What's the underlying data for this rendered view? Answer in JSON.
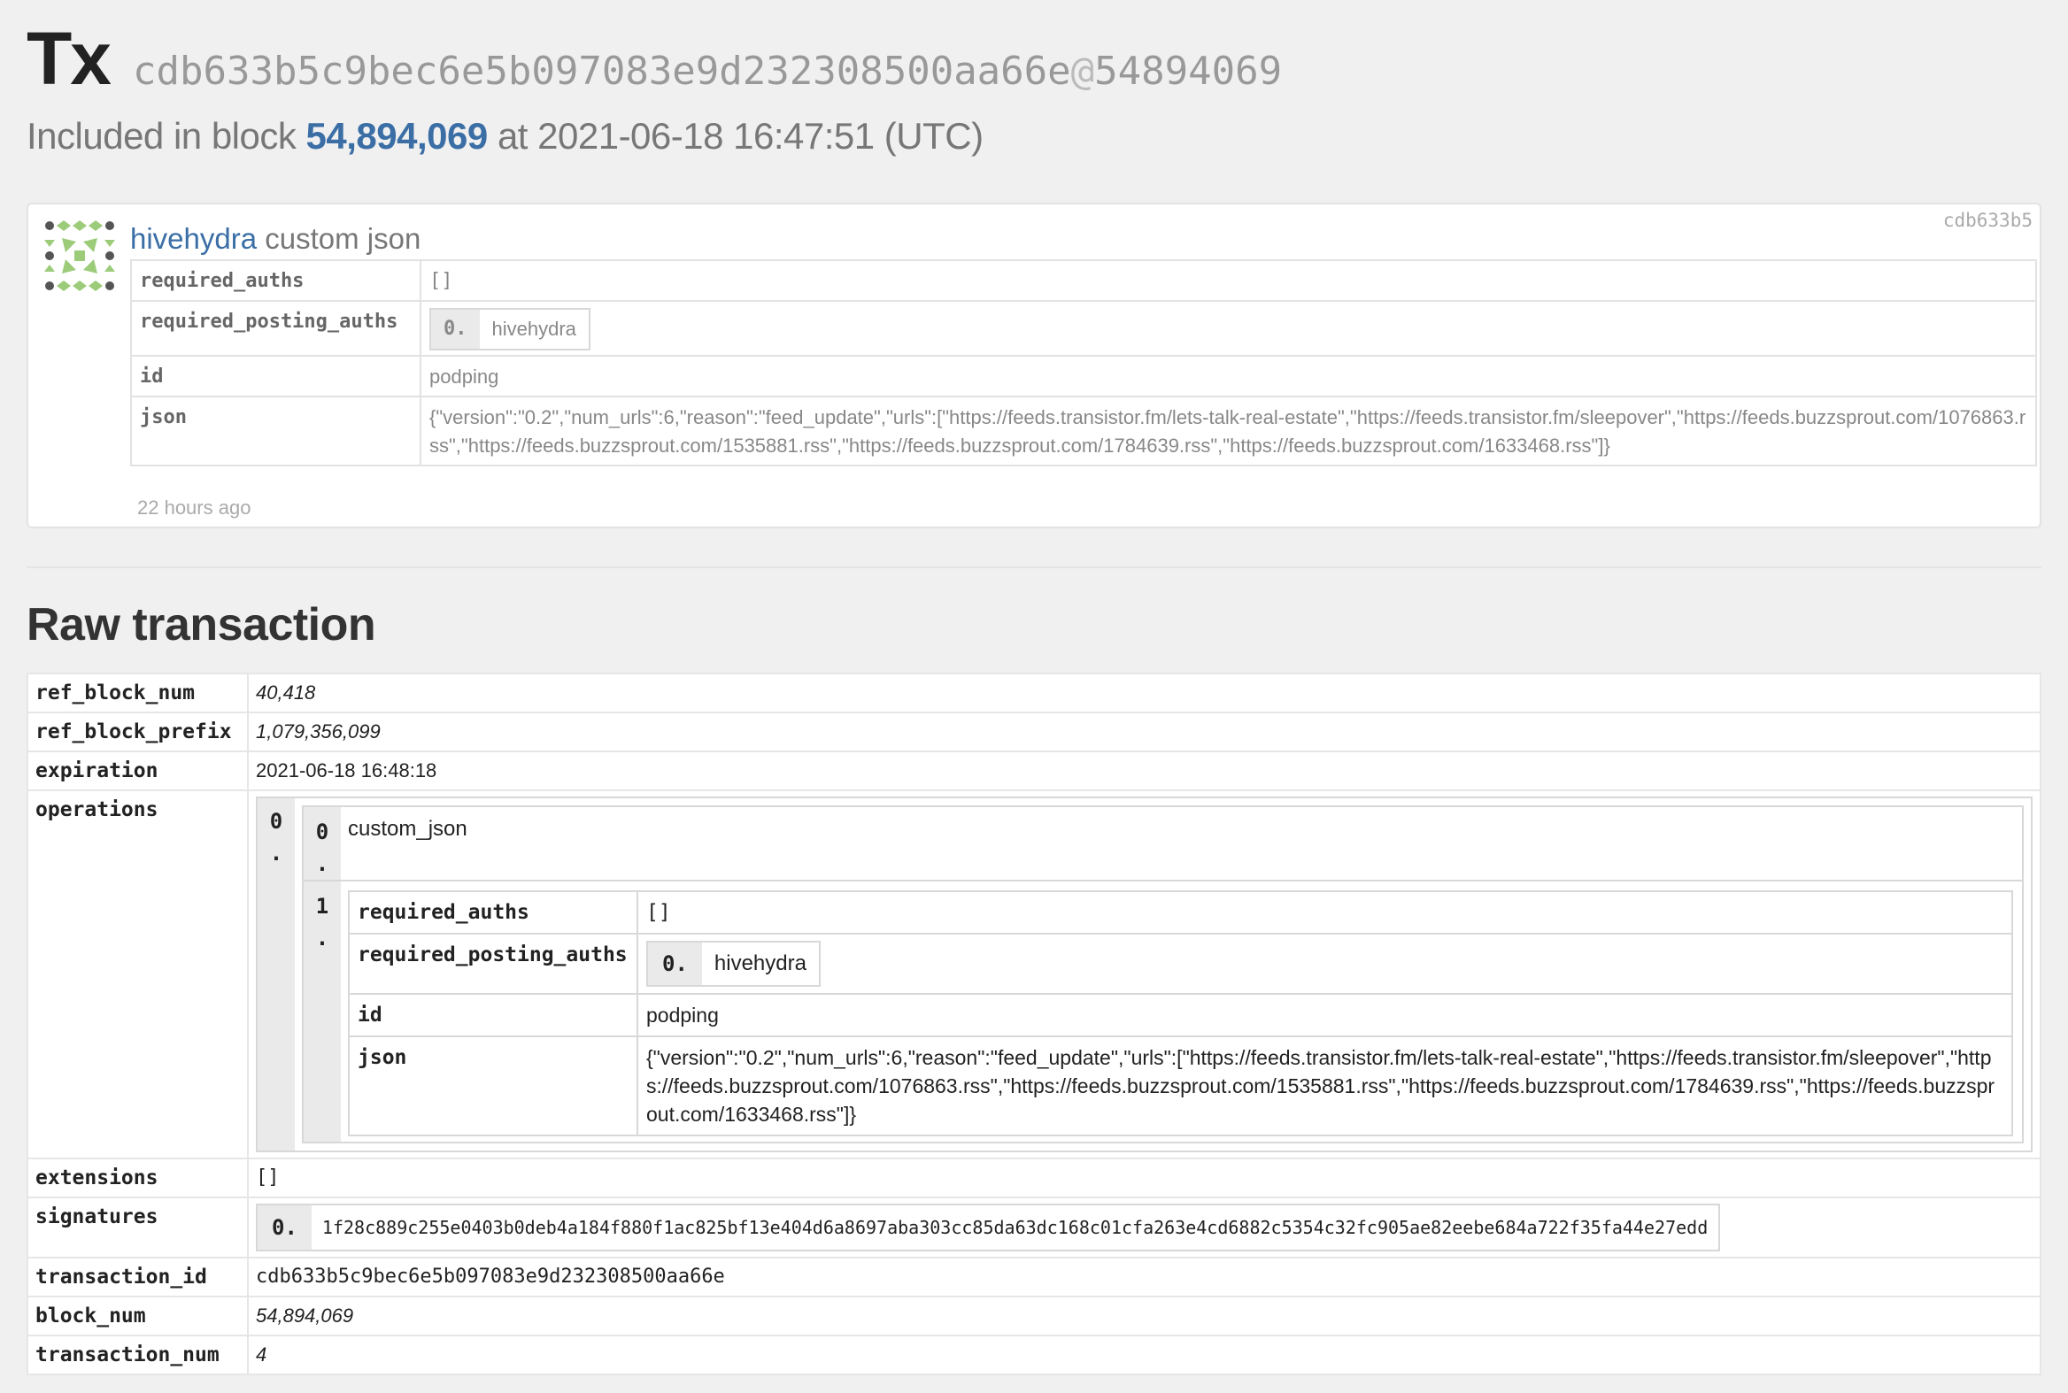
{
  "header": {
    "tx_label": "Tx",
    "hash": "cdb633b5c9bec6e5b097083e9d232308500aa66e",
    "at_sign": "@",
    "block_ref": "54894069",
    "included_prefix": "Included in block",
    "block_number": "54,894,069",
    "included_suffix": "at 2021-06-18 16:47:51 (UTC)"
  },
  "op_card": {
    "avatar_icon": "identicon-avatar",
    "user": "hivehydra",
    "op_type": "custom json",
    "short_id": "cdb633b5",
    "rows": {
      "required_auths_key": "required_auths",
      "required_auths_val": "[]",
      "required_posting_auths_key": "required_posting_auths",
      "posting_idx": "0.",
      "posting_val": "hivehydra",
      "id_key": "id",
      "id_val": "podping",
      "json_key": "json",
      "json_val": "{\"version\":\"0.2\",\"num_urls\":6,\"reason\":\"feed_update\",\"urls\":[\"https://feeds.transistor.fm/lets-talk-real-estate\",\"https://feeds.transistor.fm/sleepover\",\"https://feeds.buzzsprout.com/1076863.rss\",\"https://feeds.buzzsprout.com/1535881.rss\",\"https://feeds.buzzsprout.com/1784639.rss\",\"https://feeds.buzzsprout.com/1633468.rss\"]}"
    },
    "time_ago": "22 hours ago"
  },
  "raw": {
    "title": "Raw transaction",
    "ref_block_num_key": "ref_block_num",
    "ref_block_num_val": "40,418",
    "ref_block_prefix_key": "ref_block_prefix",
    "ref_block_prefix_val": "1,079,356,099",
    "expiration_key": "expiration",
    "expiration_val": "2021-06-18 16:48:18",
    "operations_key": "operations",
    "op_index": "0\n.",
    "pair0_idx": "0\n.",
    "pair0_val": "custom_json",
    "pair1_idx": "1\n.",
    "inner": {
      "required_auths_key": "required_auths",
      "required_auths_val": "[]",
      "required_posting_auths_key": "required_posting_auths",
      "posting_idx": "0.",
      "posting_val": "hivehydra",
      "id_key": "id",
      "id_val": "podping",
      "json_key": "json",
      "json_val": "{\"version\":\"0.2\",\"num_urls\":6,\"reason\":\"feed_update\",\"urls\":[\"https://feeds.transistor.fm/lets-talk-real-estate\",\"https://feeds.transistor.fm/sleepover\",\"https://feeds.buzzsprout.com/1076863.rss\",\"https://feeds.buzzsprout.com/1535881.rss\",\"https://feeds.buzzsprout.com/1784639.rss\",\"https://feeds.buzzsprout.com/1633468.rss\"]}"
    },
    "extensions_key": "extensions",
    "extensions_val": "[]",
    "signatures_key": "signatures",
    "sig_idx": "0.",
    "sig_val": "1f28c889c255e0403b0deb4a184f880f1ac825bf13e404d6a8697aba303cc85da63dc168c01cfa263e4cd6882c5354c32fc905ae82eebe684a722f35fa44e27edd",
    "transaction_id_key": "transaction_id",
    "transaction_id_val": "cdb633b5c9bec6e5b097083e9d232308500aa66e",
    "block_num_key": "block_num",
    "block_num_val": "54,894,069",
    "transaction_num_key": "transaction_num",
    "transaction_num_val": "4"
  }
}
